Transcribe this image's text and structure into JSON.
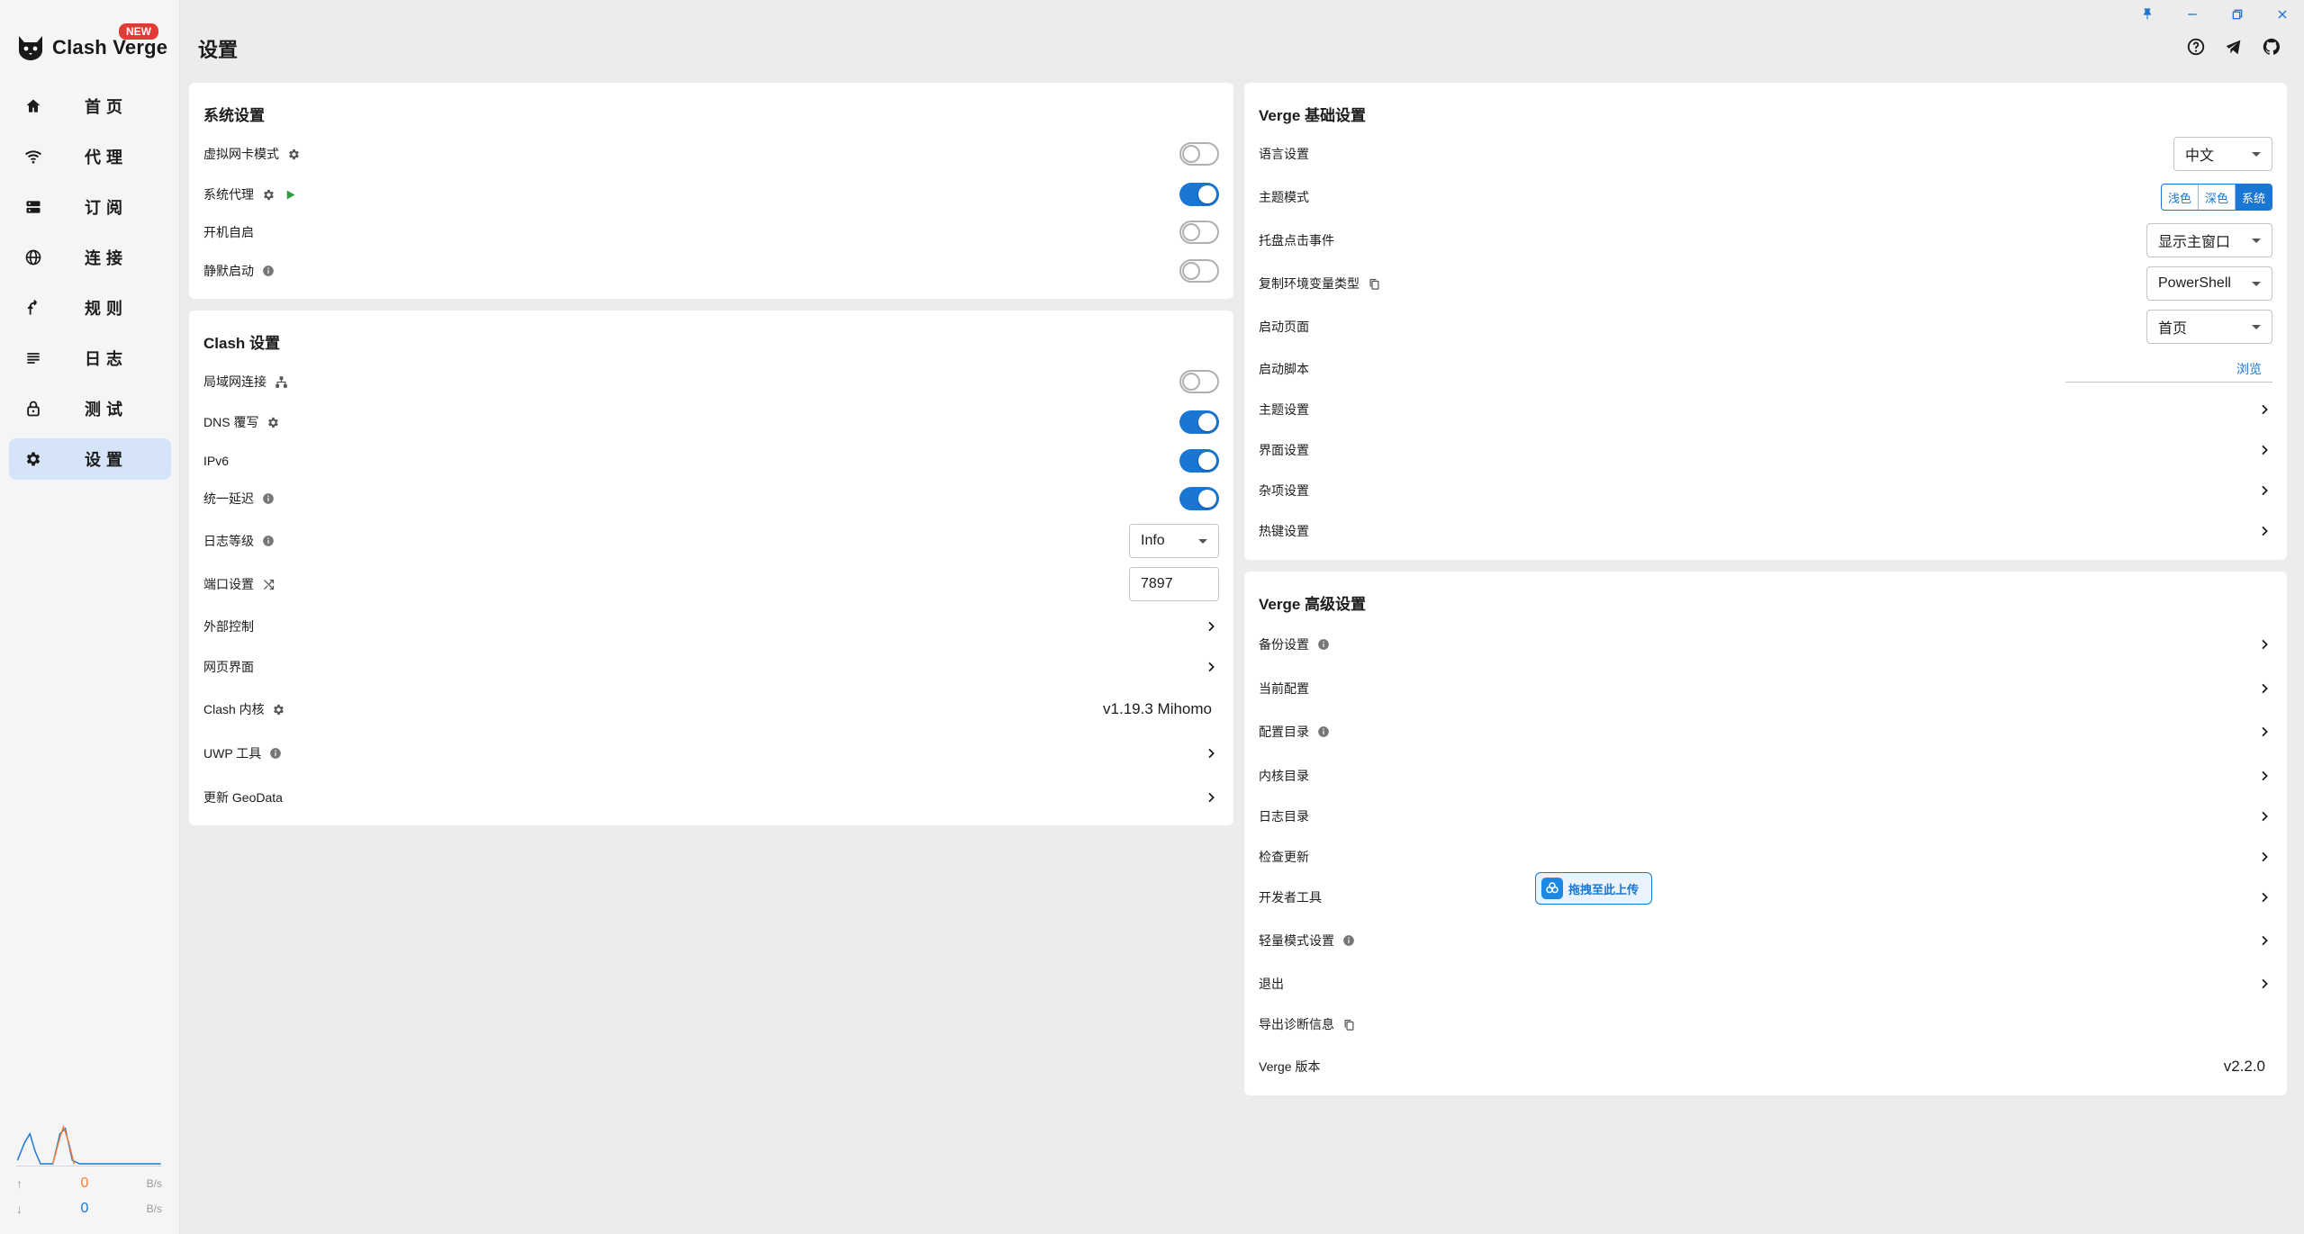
{
  "app": {
    "name": "Clash Verge",
    "badge": "NEW"
  },
  "page": {
    "title": "设置"
  },
  "sidebar": {
    "items": [
      {
        "label": "首页",
        "icon": "home-icon"
      },
      {
        "label": "代理",
        "icon": "wifi-icon"
      },
      {
        "label": "订阅",
        "icon": "dns-icon"
      },
      {
        "label": "连接",
        "icon": "globe-icon"
      },
      {
        "label": "规则",
        "icon": "fork-icon"
      },
      {
        "label": "日志",
        "icon": "list-icon"
      },
      {
        "label": "测试",
        "icon": "lock-icon"
      },
      {
        "label": "设置",
        "icon": "gear-icon",
        "active": true
      }
    ]
  },
  "traffic": {
    "up_value": "0",
    "up_unit": "B/s",
    "down_value": "0",
    "down_unit": "B/s"
  },
  "system_settings": {
    "title": "系统设置",
    "tun_mode": "虚拟网卡模式",
    "system_proxy": "系统代理",
    "auto_launch": "开机自启",
    "silent_start": "静默启动"
  },
  "clash_settings": {
    "title": "Clash 设置",
    "lan": "局域网连接",
    "dns": "DNS 覆写",
    "ipv6": "IPv6",
    "unified_delay": "统一延迟",
    "log_level": "日志等级",
    "log_level_value": "Info",
    "port": "端口设置",
    "port_value": "7897",
    "external_control": "外部控制",
    "web_ui": "网页界面",
    "core": "Clash 内核",
    "core_version": "v1.19.3 Mihomo",
    "uwp": "UWP 工具",
    "update_geodata": "更新 GeoData"
  },
  "verge_basic": {
    "title": "Verge 基础设置",
    "language": "语言设置",
    "language_value": "中文",
    "theme_mode": "主题模式",
    "theme_options": [
      "浅色",
      "深色",
      "系统"
    ],
    "tray_click": "托盘点击事件",
    "tray_click_value": "显示主窗口",
    "copy_env": "复制环境变量类型",
    "copy_env_value": "PowerShell",
    "start_page": "启动页面",
    "start_page_value": "首页",
    "startup_script": "启动脚本",
    "browse": "浏览",
    "theme_settings": "主题设置",
    "layout_settings": "界面设置",
    "misc_settings": "杂项设置",
    "hotkey_settings": "热键设置"
  },
  "verge_advanced": {
    "title": "Verge 高级设置",
    "backup": "备份设置",
    "current_config": "当前配置",
    "config_dir": "配置目录",
    "core_dir": "内核目录",
    "log_dir": "日志目录",
    "check_update": "检查更新",
    "devtools": "开发者工具",
    "lite_mode": "轻量模式设置",
    "exit": "退出",
    "export_diag": "导出诊断信息",
    "verge_version": "Verge 版本",
    "verge_version_value": "v2.2.0"
  },
  "upload_widget": {
    "label": "拖拽至此上传"
  },
  "colors": {
    "accent": "#1976d2",
    "active_nav": "#d6e4f9",
    "badge": "#e53935"
  }
}
